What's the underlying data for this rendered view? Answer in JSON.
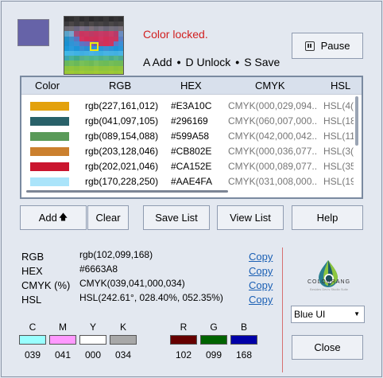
{
  "current": {
    "hex_color": "#6663A8",
    "rgb": "rgb(102,099,168)",
    "hex": "#6663A8",
    "cmyk": "CMYK(039,041,000,034)",
    "hsl": "HSL(242.61°, 028.40%, 052.35%)"
  },
  "status": {
    "locked": "Color locked.",
    "shortcut_add": "A Add",
    "shortcut_unlock": "D Unlock",
    "shortcut_save": "S Save",
    "separator": "•"
  },
  "pause_label": "Pause",
  "table": {
    "headers": [
      "Color",
      "RGB",
      "HEX",
      "CMYK",
      "HSL"
    ],
    "rows": [
      {
        "color": "#E3A10C",
        "rgb": "rgb(227,161,012)",
        "hex": "#E3A10C",
        "cmyk": "CMYK(000,029,094...",
        "hsl": "HSL(4("
      },
      {
        "color": "#296169",
        "rgb": "rgb(041,097,105)",
        "hex": "#296169",
        "cmyk": "CMYK(060,007,000...",
        "hsl": "HSL(18"
      },
      {
        "color": "#599A58",
        "rgb": "rgb(089,154,088)",
        "hex": "#599A58",
        "cmyk": "CMYK(042,000,042...",
        "hsl": "HSL(11"
      },
      {
        "color": "#CB802E",
        "rgb": "rgb(203,128,046)",
        "hex": "#CB802E",
        "cmyk": "CMYK(000,036,077...",
        "hsl": "HSL(3("
      },
      {
        "color": "#CA152E",
        "rgb": "rgb(202,021,046)",
        "hex": "#CA152E",
        "cmyk": "CMYK(000,089,077...",
        "hsl": "HSL(35"
      },
      {
        "color": "#AAE4FA",
        "rgb": "rgb(170,228,250)",
        "hex": "#AAE4FA",
        "cmyk": "CMYK(031,008,000...",
        "hsl": "HSL(19"
      }
    ]
  },
  "buttons": {
    "add": "Add",
    "clear": "Clear",
    "save_list": "Save List",
    "view_list": "View List",
    "help": "Help",
    "close": "Close"
  },
  "info": {
    "rgb_label": "RGB",
    "hex_label": "HEX",
    "cmyk_label": "CMYK (%)",
    "hsl_label": "HSL",
    "copy": "Copy"
  },
  "logo": {
    "name": "COLOURANG",
    "tagline": "Besides Dev's Studio Suite"
  },
  "theme": {
    "selected": "Blue UI"
  },
  "channels": {
    "cmyk": [
      {
        "label": "C",
        "value": "039",
        "color": "#99ffff"
      },
      {
        "label": "M",
        "value": "041",
        "color": "#ff99ff"
      },
      {
        "label": "Y",
        "value": "000",
        "color": "#ffffff"
      },
      {
        "label": "K",
        "value": "034",
        "color": "#a8a8a8"
      }
    ],
    "rgb": [
      {
        "label": "R",
        "value": "102",
        "color": "#660000"
      },
      {
        "label": "G",
        "value": "099",
        "color": "#006300"
      },
      {
        "label": "B",
        "value": "168",
        "color": "#0000a8"
      }
    ]
  },
  "colors": {
    "accent_red": "#d12020",
    "link": "#1a5fb4"
  }
}
